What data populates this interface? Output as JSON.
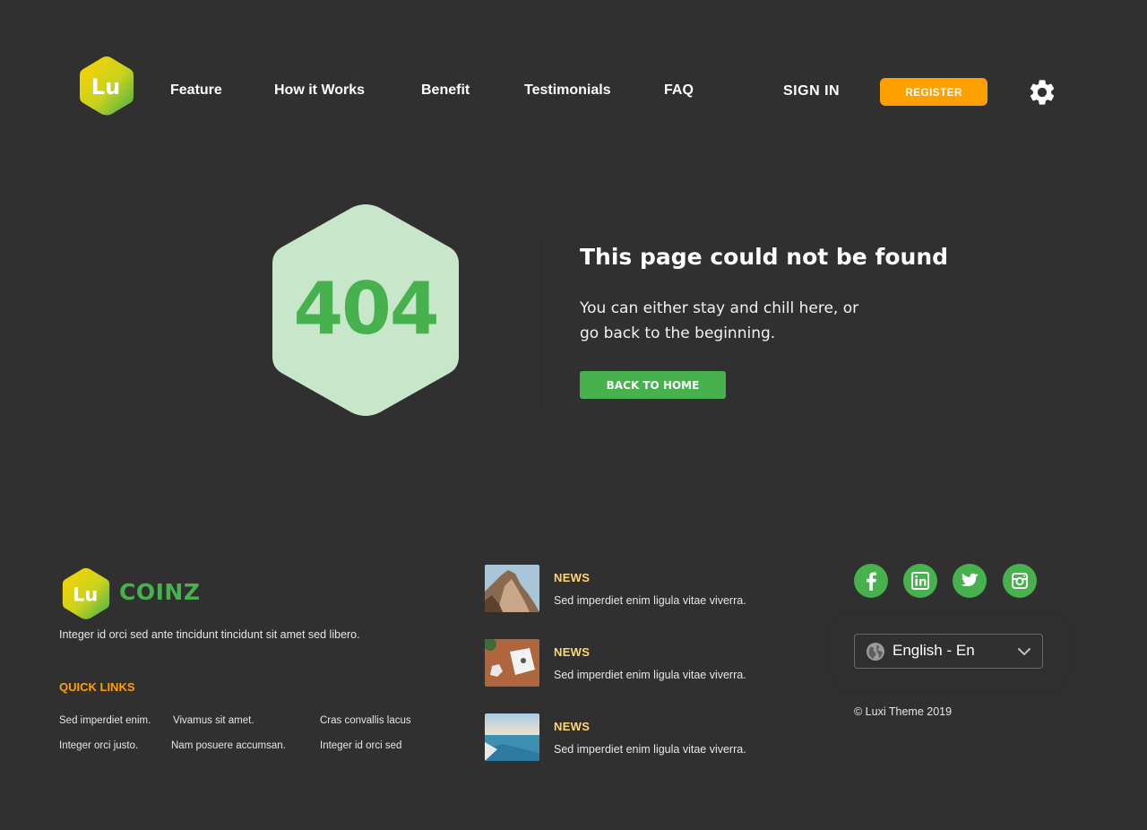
{
  "header": {
    "logo_text": "Lu",
    "nav": [
      {
        "label": "Feature"
      },
      {
        "label": "How it Works"
      },
      {
        "label": "Benefit"
      },
      {
        "label": "Testimonials"
      },
      {
        "label": "FAQ"
      }
    ],
    "sign_in": "SIGN IN",
    "register": "REGISTER"
  },
  "not_found": {
    "code": "404",
    "title": "This page could not be found",
    "line1": "You can either stay and chill here, or",
    "line2": "go back to the beginning.",
    "button": "BACK TO HOME"
  },
  "footer": {
    "logo_text": "Lu",
    "brand": "COINZ",
    "description": "Integer id orci sed ante tincidunt tincidunt sit amet sed libero.",
    "quick_links_title": "QUICK LINKS",
    "quick_links": [
      "Sed imperdiet enim.",
      "Vivamus sit amet.",
      "Cras convallis lacus",
      "Integer orci justo.",
      "Nam posuere accumsan.",
      "Integer id orci sed"
    ],
    "news": [
      {
        "label": "NEWS",
        "text": "Sed imperdiet enim ligula vitae viverra.",
        "image": "cliff-photo"
      },
      {
        "label": "NEWS",
        "text": "Sed imperdiet enim ligula vitae viverra.",
        "image": "desk-photo"
      },
      {
        "label": "NEWS",
        "text": "Sed imperdiet enim ligula vitae viverra.",
        "image": "sea-photo"
      }
    ],
    "social": [
      "facebook-icon",
      "linkedin-icon",
      "twitter-icon",
      "instagram-icon"
    ],
    "language": "English - En",
    "copyright": "© Luxi Theme 2019"
  },
  "colors": {
    "background": "#303030",
    "accent_green": "#47b14e",
    "accent_orange": "#ff9f00",
    "hex_light": "#c8e6c9",
    "news_label": "#ffd670"
  }
}
